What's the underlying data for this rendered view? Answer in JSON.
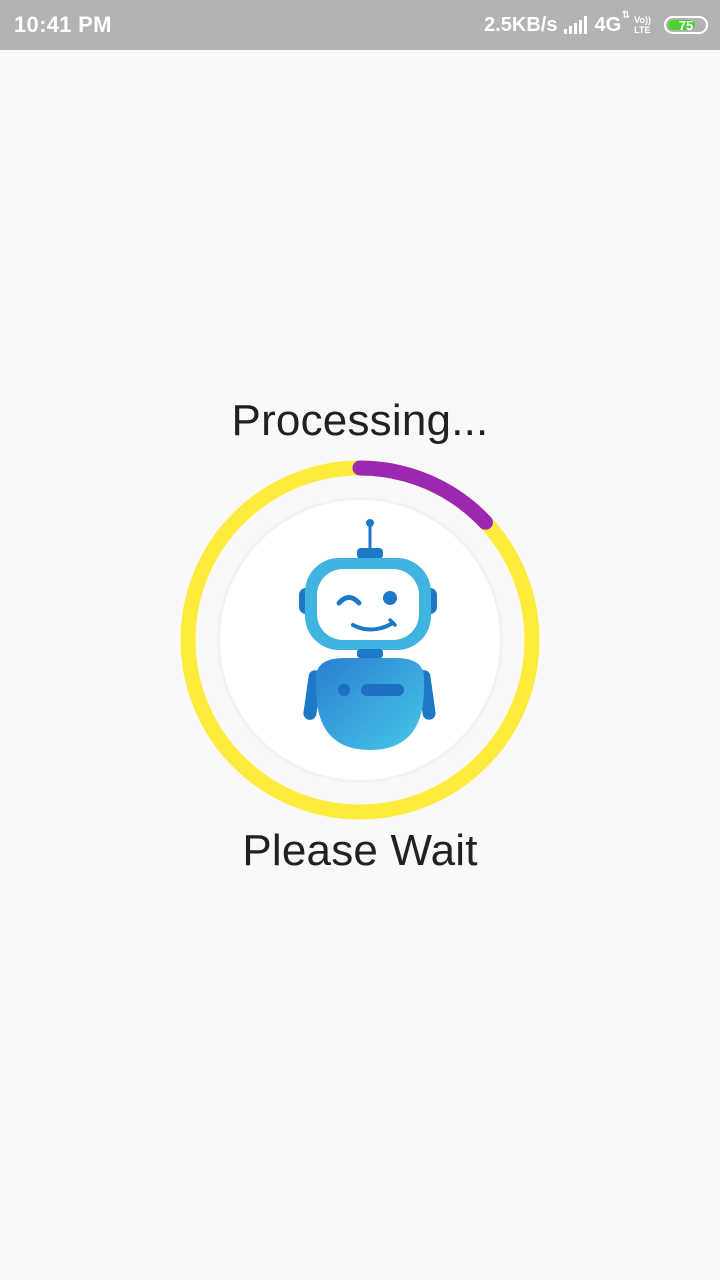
{
  "status_bar": {
    "time": "10:41 PM",
    "network_speed": "2.5KB/s",
    "network_type": "4G",
    "volte_top": "Vo))",
    "volte_bottom": "LTE",
    "battery_level": "75",
    "battery_color": "#4bd12d"
  },
  "loader": {
    "title": "Processing...",
    "subtitle": "Please Wait",
    "progress_fraction": 0.13,
    "track_color": "#ffeb3b",
    "progress_color": "#9c27b0",
    "illustration": "robot-mascot-icon"
  }
}
